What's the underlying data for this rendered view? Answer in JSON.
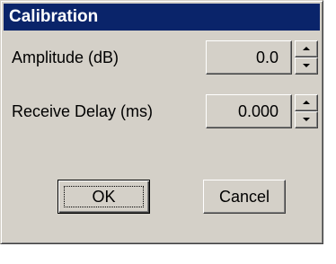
{
  "dialog": {
    "title": "Calibration"
  },
  "fields": [
    {
      "label": "Amplitude (dB)",
      "value": "0.0"
    },
    {
      "label": "Receive Delay (ms)",
      "value": "0.000"
    }
  ],
  "buttons": {
    "ok_label": "OK",
    "cancel_label": "Cancel"
  },
  "icons": {
    "spin_up": "spin-up-arrow-icon",
    "spin_down": "spin-down-arrow-icon"
  },
  "colors": {
    "titlebar": "#0a246a",
    "face": "#d4d0c8"
  }
}
